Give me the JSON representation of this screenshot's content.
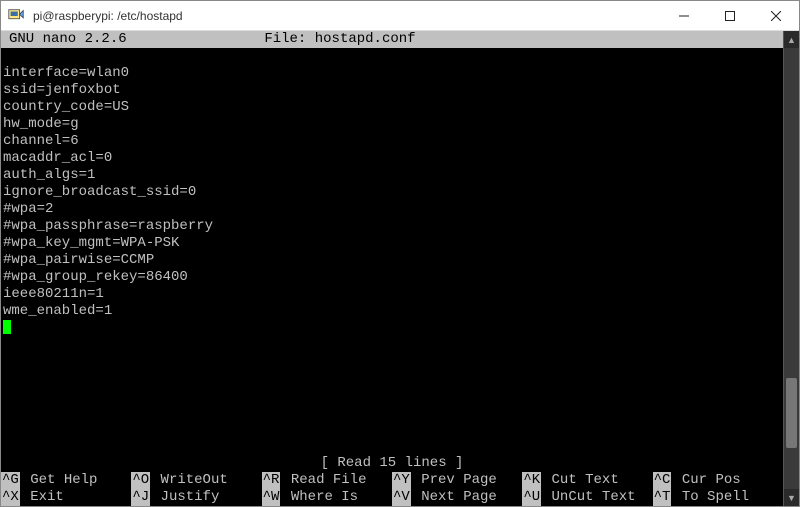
{
  "window": {
    "title": "pi@raspberypi: /etc/hostapd",
    "icon_name": "putty-icon"
  },
  "nano": {
    "app_version": "GNU nano 2.2.6",
    "file_label": "File: hostapd.conf",
    "status_message": "[ Read 15 lines ]"
  },
  "file_content": [
    "",
    "interface=wlan0",
    "ssid=jenfoxbot",
    "country_code=US",
    "hw_mode=g",
    "channel=6",
    "macaddr_acl=0",
    "auth_algs=1",
    "ignore_broadcast_ssid=0",
    "#wpa=2",
    "#wpa_passphrase=raspberry",
    "#wpa_key_mgmt=WPA-PSK",
    "#wpa_pairwise=CCMP",
    "#wpa_group_rekey=86400",
    "ieee80211n=1",
    "wme_enabled=1"
  ],
  "shortcuts_row1": [
    {
      "key": "^G",
      "label": "Get Help"
    },
    {
      "key": "^O",
      "label": "WriteOut"
    },
    {
      "key": "^R",
      "label": "Read File"
    },
    {
      "key": "^Y",
      "label": "Prev Page"
    },
    {
      "key": "^K",
      "label": "Cut Text"
    },
    {
      "key": "^C",
      "label": "Cur Pos"
    }
  ],
  "shortcuts_row2": [
    {
      "key": "^X",
      "label": "Exit"
    },
    {
      "key": "^J",
      "label": "Justify"
    },
    {
      "key": "^W",
      "label": "Where Is"
    },
    {
      "key": "^V",
      "label": "Next Page"
    },
    {
      "key": "^U",
      "label": "UnCut Text"
    },
    {
      "key": "^T",
      "label": "To Spell"
    }
  ],
  "scrollbar": {
    "up": "▲",
    "down": "▼"
  }
}
